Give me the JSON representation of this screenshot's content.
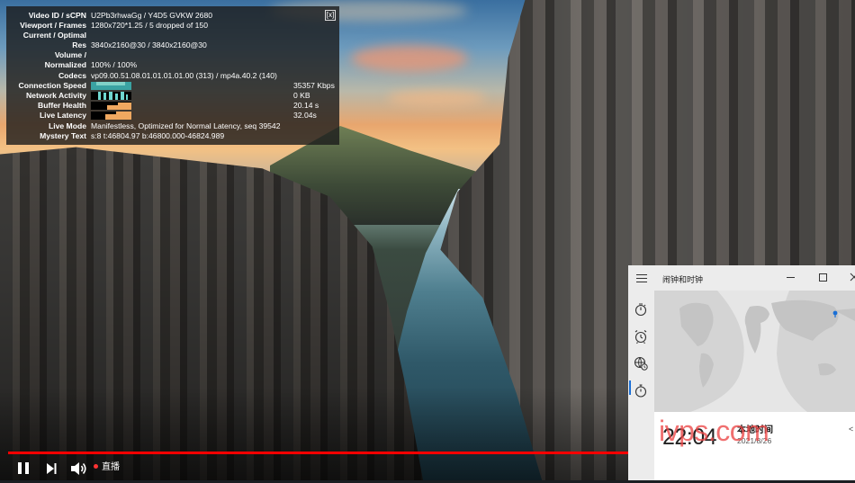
{
  "stats": {
    "close_label": "[x]",
    "rows": [
      {
        "label": "Video ID / sCPN",
        "value": "U2Pb3rhwaGg / Y4D5 GVKW 2680"
      },
      {
        "label": "Viewport / Frames",
        "value": "1280x720*1.25 / 5 dropped of 150"
      },
      {
        "label": "Current / Optimal",
        "value": ""
      },
      {
        "label": "Res",
        "value": "3840x2160@30 / 3840x2160@30"
      },
      {
        "label": "Volume /",
        "value": ""
      },
      {
        "label": "Normalized",
        "value": "100% / 100%"
      },
      {
        "label": "Codecs",
        "value": "vp09.00.51.08.01.01.01.01.00 (313) / mp4a.40.2 (140)"
      },
      {
        "label": "Connection Speed",
        "value": "",
        "right": "35357 Kbps"
      },
      {
        "label": "Network Activity",
        "value": "",
        "right": "0 KB"
      },
      {
        "label": "Buffer Health",
        "value": "",
        "right": "20.14 s"
      },
      {
        "label": "Live Latency",
        "value": "",
        "right": "32.04s"
      },
      {
        "label": "Live Mode",
        "value": "Manifestless, Optimized for Normal Latency, seq 39542"
      },
      {
        "label": "Mystery Text",
        "value": "s:8 t:46804.97 b:46800.000-46824.989"
      }
    ],
    "graph_colors": {
      "connection": "#3aa3a3",
      "network": "#6fd7d0",
      "buffer": "#f0a860",
      "latency": "#f0a860"
    }
  },
  "player": {
    "live_label": "直播",
    "progress": 1.0,
    "accent": "#ff0000"
  },
  "clock_window": {
    "title": "闹钟和时钟",
    "time": "22:04",
    "local_label": "本地时间",
    "date": "2021/8/26",
    "nav_icons": [
      "timer-icon",
      "alarm-icon",
      "world-clock-icon",
      "stopwatch-icon"
    ],
    "accent": "#1a6fd6"
  },
  "watermark": "ivps.com"
}
